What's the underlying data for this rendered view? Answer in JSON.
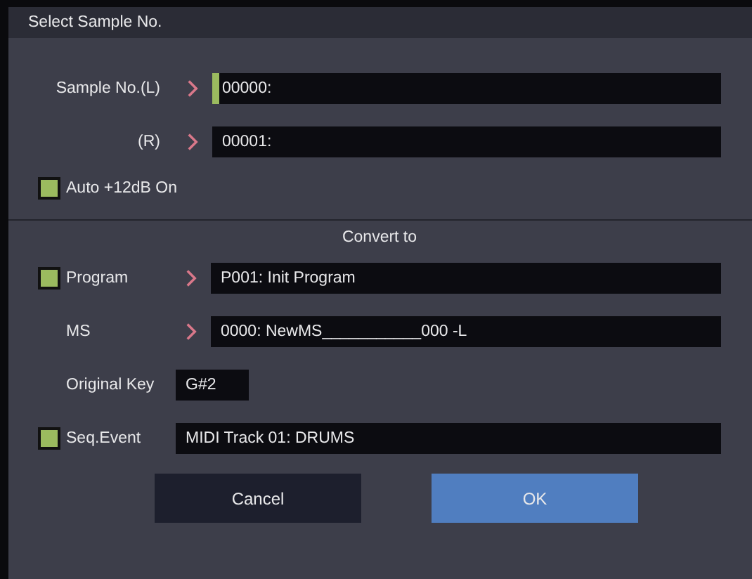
{
  "dialog": {
    "title": "Select Sample No."
  },
  "sample_rows": [
    {
      "label": "Sample No.(L)",
      "value": "00000:",
      "focused": true
    },
    {
      "label": "(R)",
      "value": "00001:",
      "focused": false
    }
  ],
  "auto_gain": {
    "label": "Auto +12dB On",
    "checked": true
  },
  "convert": {
    "heading": "Convert to",
    "rows": [
      {
        "kind": "check-arrow",
        "label": "Program",
        "checked": true,
        "value": "P001: Init Program"
      },
      {
        "kind": "arrow",
        "label": "MS",
        "value": "0000: NewMS___________000 -L"
      },
      {
        "kind": "short",
        "label": "Original Key",
        "value": "G#2"
      },
      {
        "kind": "check",
        "label": "Seq.Event",
        "checked": true,
        "value": "MIDI Track 01: DRUMS"
      }
    ]
  },
  "buttons": [
    {
      "label": "Cancel",
      "kind": "secondary"
    },
    {
      "label": "OK",
      "kind": "primary"
    }
  ]
}
